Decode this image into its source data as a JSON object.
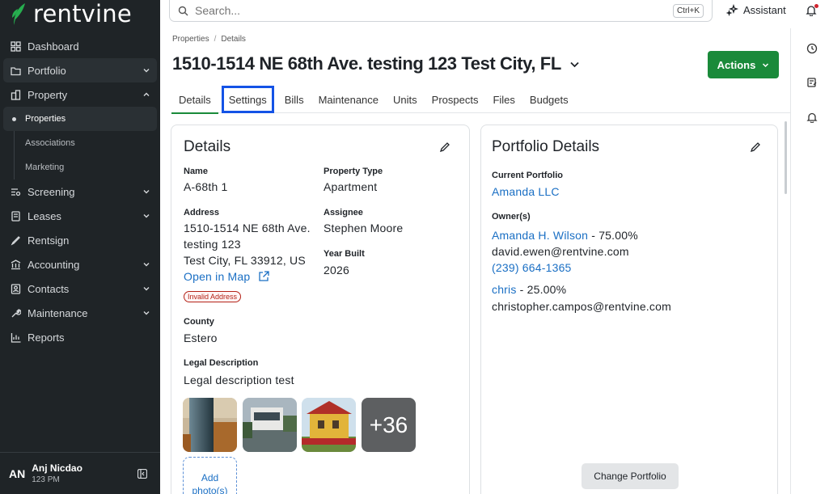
{
  "brand": {
    "name": "rentvine",
    "accent": "#1a8a3a"
  },
  "sidebar": {
    "items": [
      {
        "label": "Dashboard",
        "icon": "dashboard-icon"
      },
      {
        "label": "Portfolio",
        "icon": "portfolio-icon",
        "expandable": true
      },
      {
        "label": "Property",
        "icon": "property-icon",
        "expanded": true
      },
      {
        "label": "Screening",
        "icon": "screening-icon",
        "expandable": true
      },
      {
        "label": "Leases",
        "icon": "leases-icon",
        "expandable": true
      },
      {
        "label": "Rentsign",
        "icon": "rentsign-icon"
      },
      {
        "label": "Accounting",
        "icon": "accounting-icon",
        "expandable": true
      },
      {
        "label": "Contacts",
        "icon": "contacts-icon",
        "expandable": true
      },
      {
        "label": "Maintenance",
        "icon": "maintenance-icon",
        "expandable": true
      },
      {
        "label": "Reports",
        "icon": "reports-icon"
      }
    ],
    "property_sub": [
      "Properties",
      "Associations",
      "Marketing"
    ],
    "user": {
      "initials": "AN",
      "name": "Anj Nicdao",
      "time": "123 PM"
    }
  },
  "topbar": {
    "search_placeholder": "Search...",
    "shortcut": "Ctrl+K",
    "assistant_label": "Assistant"
  },
  "breadcrumb": {
    "root": "Properties",
    "current": "Details"
  },
  "page": {
    "title": "1510-1514 NE 68th Ave. testing 123 Test City, FL",
    "actions_label": "Actions"
  },
  "tabs": [
    "Details",
    "Settings",
    "Bills",
    "Maintenance",
    "Units",
    "Prospects",
    "Files",
    "Budgets"
  ],
  "details": {
    "title": "Details",
    "name_label": "Name",
    "name": "A-68th 1",
    "address_label": "Address",
    "address_line1": "1510-1514 NE 68th Ave.",
    "address_line2": "testing 123",
    "address_line3": "Test City, FL 33912, US",
    "open_map": "Open in Map",
    "invalid_badge": "Invalid Address",
    "county_label": "County",
    "county": "Estero",
    "legal_label": "Legal Description",
    "legal": "Legal description test",
    "type_label": "Property Type",
    "type": "Apartment",
    "assignee_label": "Assignee",
    "assignee": "Stephen Moore",
    "year_label": "Year Built",
    "year": "2026",
    "more_photos": "+36",
    "add_photo_1": "Add",
    "add_photo_2": "photo(s)"
  },
  "portfolio": {
    "title": "Portfolio Details",
    "current_label": "Current Portfolio",
    "current": "Amanda LLC",
    "owners_label": "Owner(s)",
    "owners": [
      {
        "name": "Amanda H. Wilson",
        "pct": "75.00%",
        "email": "david.ewen@rentvine.com",
        "phone": "(239) 664-1365"
      },
      {
        "name": "chris",
        "pct": "25.00%",
        "email": "christopher.campos@rentvine.com"
      }
    ],
    "change_label": "Change Portfolio"
  }
}
